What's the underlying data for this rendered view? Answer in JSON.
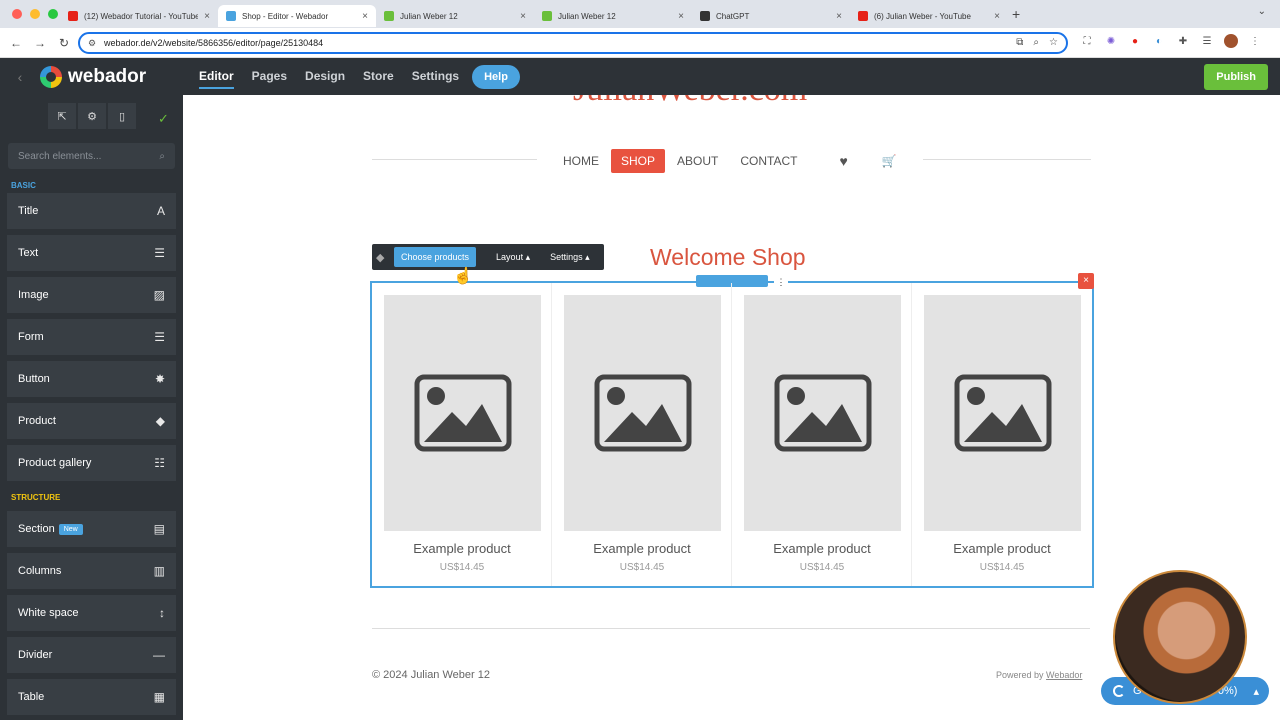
{
  "browser": {
    "tabs": [
      {
        "title": "(12) Webador Tutorial - YouTube",
        "favicon_color": "#e62117",
        "active": false
      },
      {
        "title": "Shop - Editor - Webador",
        "favicon_color": "#4aa3df",
        "active": true
      },
      {
        "title": "Julian Weber 12",
        "favicon_color": "#6abf3b",
        "active": false
      },
      {
        "title": "Julian Weber 12",
        "favicon_color": "#6abf3b",
        "active": false
      },
      {
        "title": "ChatGPT",
        "favicon_color": "#333333",
        "active": false
      },
      {
        "title": "(6) Julian Weber - YouTube",
        "favicon_color": "#e62117",
        "active": false
      }
    ],
    "url": "webador.de/v2/website/5866356/editor/page/25130484"
  },
  "appbar": {
    "logo": "webador",
    "menu": [
      "Editor",
      "Pages",
      "Design",
      "Store",
      "Settings"
    ],
    "active_menu": "Editor",
    "help": "Help",
    "publish": "Publish"
  },
  "sidebar": {
    "search_placeholder": "Search elements...",
    "basic_label": "BASIC",
    "basic_items": [
      {
        "label": "Title",
        "icon": "title-icon",
        "glyph": "A"
      },
      {
        "label": "Text",
        "icon": "text-icon",
        "glyph": "☰"
      },
      {
        "label": "Image",
        "icon": "image-icon",
        "glyph": "▨"
      },
      {
        "label": "Form",
        "icon": "form-icon",
        "glyph": "☰"
      },
      {
        "label": "Button",
        "icon": "button-icon",
        "glyph": "✸"
      },
      {
        "label": "Product",
        "icon": "tag-icon",
        "glyph": "◆"
      },
      {
        "label": "Product gallery",
        "icon": "list-icon",
        "glyph": "☷"
      }
    ],
    "structure_label": "STRUCTURE",
    "structure_items": [
      {
        "label": "Section",
        "badge": "New",
        "icon": "section-icon",
        "glyph": "▤"
      },
      {
        "label": "Columns",
        "icon": "columns-icon",
        "glyph": "▥"
      },
      {
        "label": "White space",
        "icon": "whitespace-icon",
        "glyph": "↕"
      },
      {
        "label": "Divider",
        "icon": "divider-icon",
        "glyph": "—"
      },
      {
        "label": "Table",
        "icon": "table-icon",
        "glyph": "▦"
      }
    ]
  },
  "page": {
    "site_title": "JulianWeber.com",
    "nav": [
      "HOME",
      "SHOP",
      "ABOUT",
      "CONTACT"
    ],
    "active_nav": "SHOP",
    "toolbar": {
      "choose_products": "Choose products",
      "layout": "Layout ▴",
      "settings": "Settings ▴"
    },
    "welcome": "Welcome Shop",
    "products": [
      {
        "name": "Example product",
        "price": "US$14.45"
      },
      {
        "name": "Example product",
        "price": "US$14.45"
      },
      {
        "name": "Example product",
        "price": "US$14.45"
      },
      {
        "name": "Example product",
        "price": "US$14.45"
      }
    ],
    "copyright": "© 2024 Julian Weber 12",
    "powered_prefix": "Powered by ",
    "powered_link": "Webador"
  },
  "floating": {
    "pill_text": "G",
    "pill_pct": "0%)"
  },
  "colors": {
    "accent": "#4aa3df",
    "brand_red": "#e8523f",
    "publish_green": "#6abf3b"
  }
}
